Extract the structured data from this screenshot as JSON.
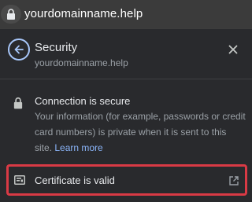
{
  "omnibox": {
    "url": "yourdomainname.help",
    "lock_icon": "lock-icon"
  },
  "header": {
    "title": "Security",
    "subtitle": "yourdomainname.help",
    "back_icon": "back-arrow-icon",
    "close_icon": "close-icon"
  },
  "connection": {
    "title": "Connection is secure",
    "description": "Your information (for example, passwords or credit card numbers) is private when it is sent to this site.",
    "learn_more": "Learn more",
    "icon": "lock-icon"
  },
  "certificate": {
    "label": "Certificate is valid",
    "icon": "certificate-icon",
    "external_icon": "external-link-icon",
    "highlight_color": "#d93a45"
  },
  "colors": {
    "accent": "#8ab4f8",
    "panel_bg": "#292a2d"
  }
}
